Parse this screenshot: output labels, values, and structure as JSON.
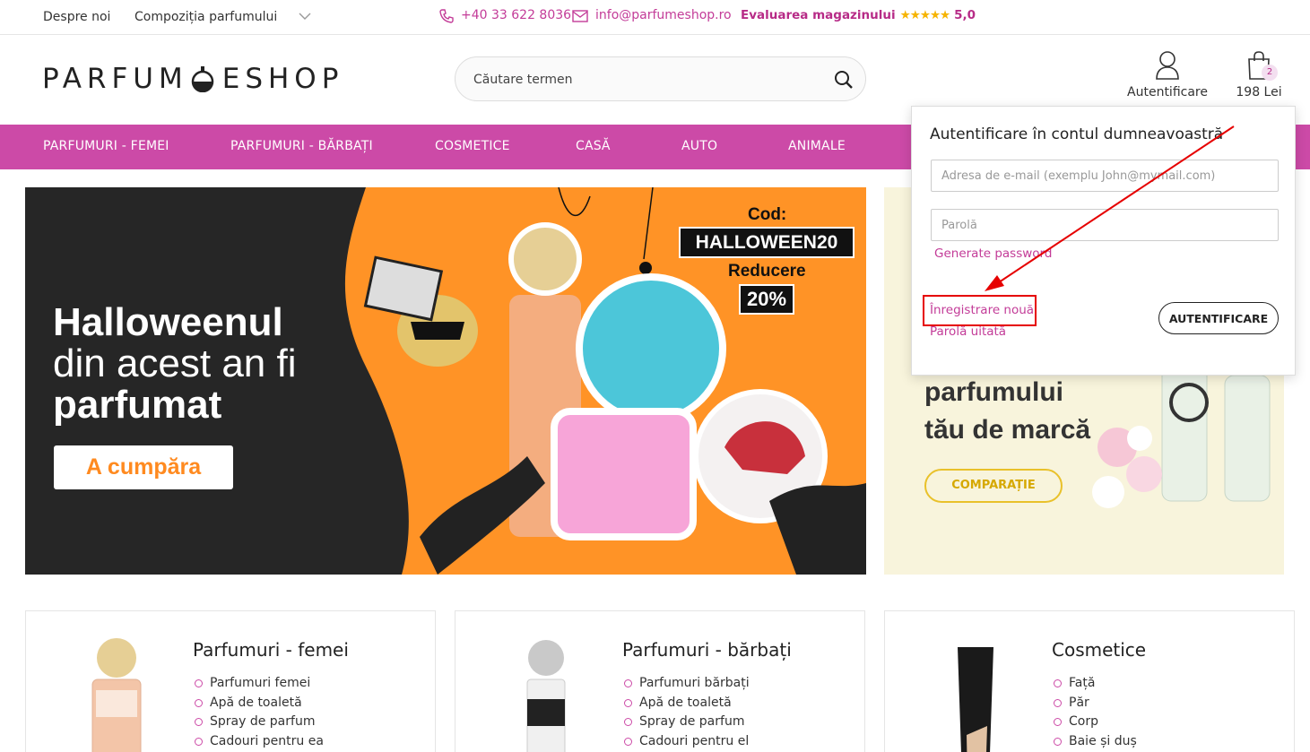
{
  "topbar": {
    "about": "Despre noi",
    "composition": "Compoziția parfumului",
    "phone": "+40 33 622 8036",
    "email": "info@parfumeshop.ro",
    "rating_label": "Evaluarea magazinului",
    "rating_stars": "★★★★★",
    "rating_value": "5,0"
  },
  "header": {
    "logo_left": "PARFUM",
    "logo_right": "ESHOP",
    "search_placeholder": "Căutare termen",
    "account_label": "Autentificare",
    "cart_count": "2",
    "cart_amount": "198 Lei"
  },
  "nav": [
    "PARFUMURI - FEMEI",
    "PARFUMURI - BĂRBAȚI",
    "COSMETICE",
    "CASĂ",
    "AUTO",
    "ANIMALE"
  ],
  "hero": {
    "title_1": "Halloweenul",
    "title_2": "din acest an fi",
    "title_3": "parfumat",
    "button": "A cumpăra",
    "cod_label": "Cod:",
    "code": "HALLOWEEN20",
    "discount_label": "Reducere",
    "discount": "20%"
  },
  "promo": {
    "line1": "parfumului",
    "line2": "tău de marcă",
    "button": "COMPARAȚIE"
  },
  "login": {
    "title": "Autentificare în contul dumneavoastră",
    "email_placeholder": "Adresa de e-mail (exemplu John@mymail.com)",
    "password_placeholder": "Parolă",
    "generate": "Generate password",
    "register": "Înregistrare nouă",
    "forgot": "Parolă uitată",
    "submit": "AUTENTIFICARE"
  },
  "cards": [
    {
      "title": "Parfumuri - femei",
      "items": [
        "Parfumuri femei",
        "Apă de toaletă",
        "Spray de parfum",
        "Cadouri pentru ea"
      ]
    },
    {
      "title": "Parfumuri - bărbați",
      "items": [
        "Parfumuri bărbați",
        "Apă de toaletă",
        "Spray de parfum",
        "Cadouri pentru el"
      ]
    },
    {
      "title": "Cosmetice",
      "items": [
        "Față",
        "Păr",
        "Corp",
        "Baie și duș"
      ]
    }
  ],
  "colors": {
    "brand": "#cc4aa7",
    "link": "#c33c98",
    "hero_orange": "#ff9326",
    "highlight": "#e60000"
  }
}
